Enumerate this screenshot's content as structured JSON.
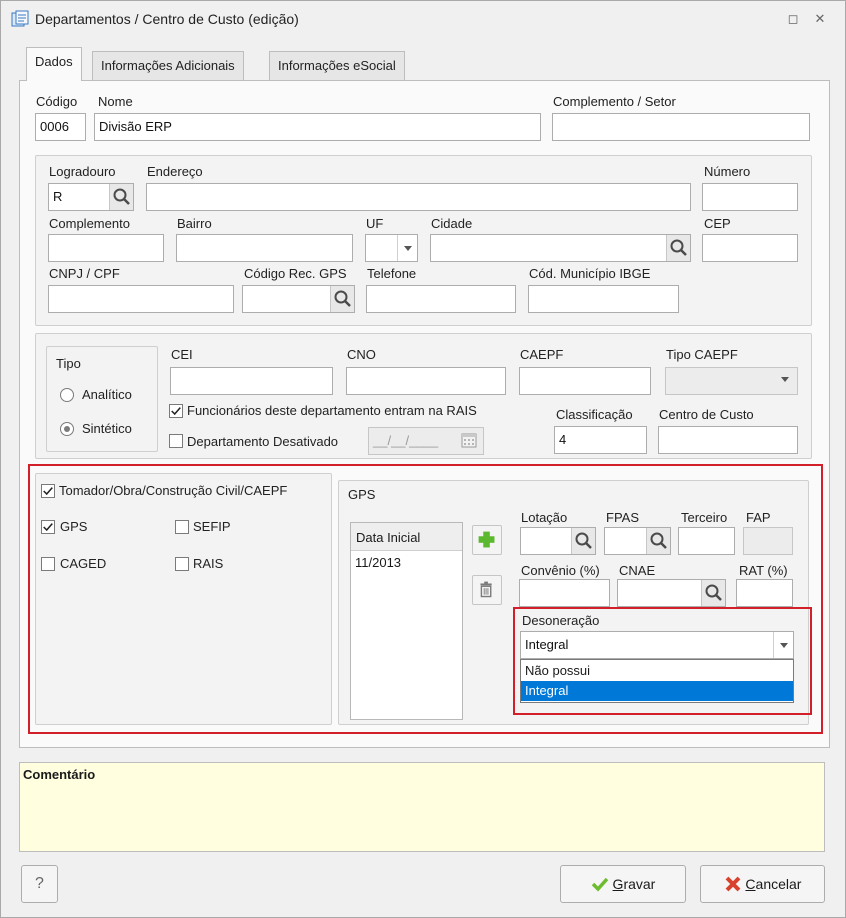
{
  "window": {
    "title": "Departamentos / Centro de Custo (edição)",
    "restore_glyph": "◻",
    "close_glyph": "✕"
  },
  "tabs": [
    {
      "label": "Dados",
      "active": true
    },
    {
      "label": "Informações Adicionais",
      "active": false
    },
    {
      "label": "Informações eSocial",
      "active": false
    }
  ],
  "header_fields": {
    "codigo_label": "Código",
    "codigo_value": "0006",
    "nome_label": "Nome",
    "nome_value": "Divisão ERP",
    "complemento_setor_label": "Complemento / Setor",
    "complemento_setor_value": ""
  },
  "address": {
    "logradouro_label": "Logradouro",
    "logradouro_value": "R",
    "endereco_label": "Endereço",
    "numero_label": "Número",
    "complemento_label": "Complemento",
    "bairro_label": "Bairro",
    "uf_label": "UF",
    "cidade_label": "Cidade",
    "cep_label": "CEP",
    "cnpj_label": "CNPJ / CPF",
    "codigo_rec_gps_label": "Código Rec. GPS",
    "telefone_label": "Telefone",
    "cod_municipio_label": "Cód. Município IBGE"
  },
  "tipo": {
    "title": "Tipo",
    "analitico": "Analítico",
    "sintetico": "Sintético",
    "selected": "Sintético"
  },
  "ids": {
    "cei_label": "CEI",
    "cno_label": "CNO",
    "caepf_label": "CAEPF",
    "tipo_caepf_label": "Tipo CAEPF",
    "rais_checkbox": "Funcionários deste departamento entram na RAIS",
    "desativado_checkbox": "Departamento Desativado",
    "date_placeholder": "__/__/____",
    "classificacao_label": "Classificação",
    "classificacao_value": "4",
    "centro_custo_label": "Centro de Custo"
  },
  "tomador": {
    "checkbox_label": "Tomador/Obra/Construção Civil/CAEPF",
    "gps": "GPS",
    "sefip": "SEFIP",
    "caged": "CAGED",
    "rais": "RAIS"
  },
  "gps_panel": {
    "title": "GPS",
    "list_header": "Data Inicial",
    "list_items": [
      "11/2013"
    ],
    "lotacao_label": "Lotação",
    "fpas_label": "FPAS",
    "terceiro_label": "Terceiro",
    "fap_label": "FAP",
    "convenio_label": "Convênio (%)",
    "cnae_label": "CNAE",
    "rat_label": "RAT (%)",
    "desoneracao_label": "Desoneração",
    "desoneracao_value": "Integral",
    "desoneracao_options": [
      "Não possui",
      "Integral"
    ],
    "desoneracao_highlighted": "Integral"
  },
  "comment": {
    "label": "Comentário"
  },
  "footer": {
    "help": "?",
    "save": "Gravar",
    "save_underline": "G",
    "save_rest": "ravar",
    "cancel_underline": "C",
    "cancel_rest": "ancelar"
  },
  "colors": {
    "highlight_box": "#d21f2a",
    "selection": "#0078d7",
    "comment_bg": "#ffffe0",
    "add_green": "#5cb82e",
    "cancel_red": "#d8412c"
  }
}
